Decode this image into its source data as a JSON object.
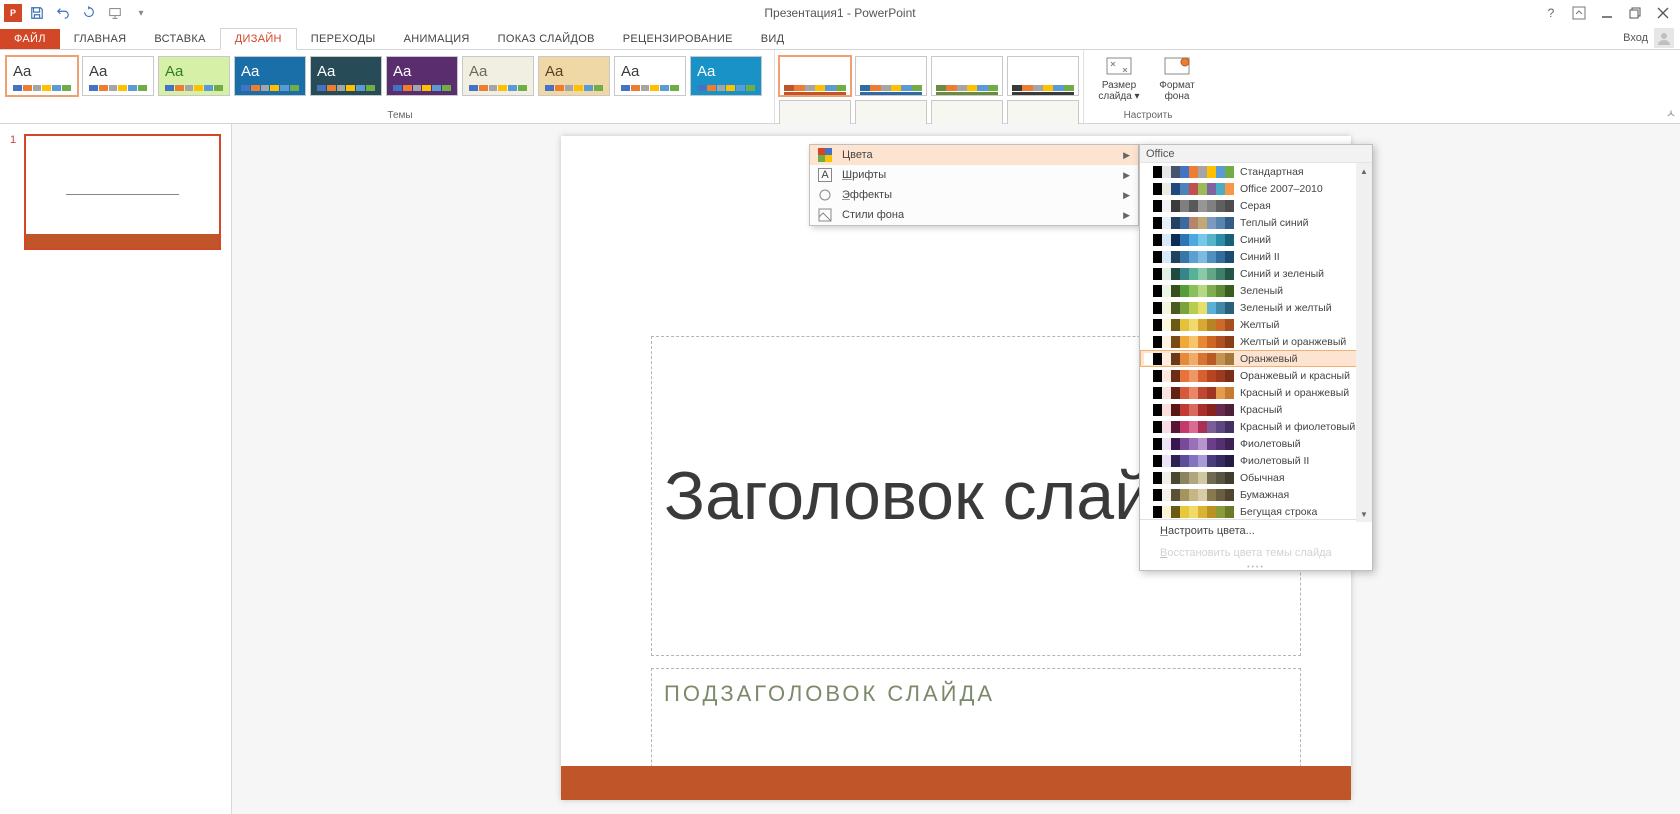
{
  "title": "Презентация1 - PowerPoint",
  "signin": "Вход",
  "tabs": {
    "file": "ФАЙЛ",
    "home": "ГЛАВНАЯ",
    "insert": "ВСТАВКА",
    "design": "ДИЗАЙН",
    "transitions": "ПЕРЕХОДЫ",
    "animations": "АНИМАЦИЯ",
    "slideshow": "ПОКАЗ СЛАЙДОВ",
    "review": "РЕЦЕНЗИРОВАНИЕ",
    "view": "ВИД"
  },
  "ribbon": {
    "themesLabel": "Темы",
    "customizeLabel": "Настроить",
    "slideSize": "Размер слайда",
    "formatBg": "Формат фона",
    "themes": [
      {
        "bg": "#ffffff",
        "fg": "#3b3b3b",
        "selected": true
      },
      {
        "bg": "#ffffff",
        "fg": "#3b3b3b"
      },
      {
        "bg": "#d7f0a8",
        "fg": "#2f7d1f",
        "pattern": "green"
      },
      {
        "bg": "#1b6fa8",
        "fg": "#ffffff",
        "pattern": "blue"
      },
      {
        "bg": "#274c58",
        "fg": "#ffffff"
      },
      {
        "bg": "#5a2e6e",
        "fg": "#ffffff"
      },
      {
        "bg": "#f0efe1",
        "fg": "#6b6b55"
      },
      {
        "bg": "#f0d8a6",
        "fg": "#5a4020",
        "pattern": "wood"
      },
      {
        "bg": "#ffffff",
        "fg": "#3b3b3b"
      },
      {
        "bg": "#1992c8",
        "fg": "#ffffff"
      }
    ],
    "variants": [
      {
        "accent": "#c0552a",
        "selected": true
      },
      {
        "accent": "#2e6ca4"
      },
      {
        "accent": "#6a8c3e"
      },
      {
        "accent": "#3a3a3a"
      },
      {
        "accent": "#35a3b0"
      },
      {
        "accent": "#b54630"
      },
      {
        "accent": "#8e9a78"
      },
      {
        "accent": "#4a4660"
      }
    ]
  },
  "submenu": {
    "colors": "Цвета",
    "fonts": "Шрифты",
    "effects": "Эффекты",
    "bgStyles": "Стили фона"
  },
  "flyout": {
    "header": "Office",
    "customize": "Настроить цвета...",
    "reset": "Восстановить цвета темы слайда",
    "schemes": [
      {
        "name": "Стандартная",
        "c": [
          "#ffffff",
          "#000000",
          "#e7e6e6",
          "#44546a",
          "#4472c4",
          "#ed7d31",
          "#a5a5a5",
          "#ffc000",
          "#5b9bd5",
          "#70ad47"
        ]
      },
      {
        "name": "Office 2007–2010",
        "c": [
          "#ffffff",
          "#000000",
          "#eeece1",
          "#1f497d",
          "#4f81bd",
          "#c0504d",
          "#9bbb59",
          "#8064a2",
          "#4bacc6",
          "#f79646"
        ]
      },
      {
        "name": "Серая",
        "c": [
          "#ffffff",
          "#000000",
          "#f2f2f2",
          "#3b3b3b",
          "#7f7f7f",
          "#595959",
          "#969696",
          "#808080",
          "#5f5f5f",
          "#4d4d4d"
        ]
      },
      {
        "name": "Теплый синий",
        "c": [
          "#ffffff",
          "#000000",
          "#e7eff7",
          "#254061",
          "#3b6aa0",
          "#b4846c",
          "#c1a875",
          "#7a9ac0",
          "#5884b0",
          "#355b87"
        ]
      },
      {
        "name": "Синий",
        "c": [
          "#ffffff",
          "#000000",
          "#dae9f7",
          "#0d2c54",
          "#2e75b6",
          "#4ea8de",
          "#76c7e8",
          "#55b4c8",
          "#2b8ea9",
          "#17607a"
        ]
      },
      {
        "name": "Синий II",
        "c": [
          "#ffffff",
          "#000000",
          "#d8e7f5",
          "#204060",
          "#3776a8",
          "#5aa0d0",
          "#7bbbe0",
          "#4f90c0",
          "#2f6f9f",
          "#1d4c72"
        ]
      },
      {
        "name": "Синий и зеленый",
        "c": [
          "#ffffff",
          "#000000",
          "#e2efe6",
          "#1f4a3f",
          "#37858b",
          "#56b196",
          "#8cc8a6",
          "#61a786",
          "#3c8068",
          "#255645"
        ]
      },
      {
        "name": "Зеленый",
        "c": [
          "#ffffff",
          "#000000",
          "#edf5e4",
          "#374e1f",
          "#549e39",
          "#8bbf5a",
          "#b6d884",
          "#7fae4f",
          "#5d8d35",
          "#3a5e21"
        ]
      },
      {
        "name": "Зеленый и желтый",
        "c": [
          "#ffffff",
          "#000000",
          "#f4f6dc",
          "#4a5a22",
          "#7aa23f",
          "#b8cc52",
          "#e6e06a",
          "#5bb0d8",
          "#3e8aa8",
          "#2a6178"
        ]
      },
      {
        "name": "Желтый",
        "c": [
          "#ffffff",
          "#000000",
          "#fdf7df",
          "#6b5a16",
          "#e3c13b",
          "#f0d96a",
          "#d8a832",
          "#b88322",
          "#cc6a28",
          "#a64f1f"
        ]
      },
      {
        "name": "Желтый и оранжевый",
        "c": [
          "#ffffff",
          "#000000",
          "#fef3e2",
          "#7a4a16",
          "#f0a83b",
          "#f4c56a",
          "#e78832",
          "#cc6622",
          "#b04f1f",
          "#8a3e18"
        ]
      },
      {
        "name": "Оранжевый",
        "hl": true,
        "c": [
          "#ffffff",
          "#000000",
          "#fdeee0",
          "#6b3a16",
          "#e6893b",
          "#f0aa6a",
          "#d87432",
          "#b85a22",
          "#c69450",
          "#a67838"
        ]
      },
      {
        "name": "Оранжевый и красный",
        "c": [
          "#ffffff",
          "#000000",
          "#fce8df",
          "#6a2e16",
          "#e6733b",
          "#ef9666",
          "#d85f32",
          "#b84522",
          "#a03a1d",
          "#7a2e17"
        ]
      },
      {
        "name": "Красный и оранжевый",
        "c": [
          "#ffffff",
          "#000000",
          "#fbe4df",
          "#642216",
          "#d8583b",
          "#e88666",
          "#c04632",
          "#a03622",
          "#e69a4a",
          "#c67a32"
        ]
      },
      {
        "name": "Красный",
        "c": [
          "#ffffff",
          "#000000",
          "#f9dedc",
          "#5a1614",
          "#c23a34",
          "#d86a60",
          "#a83028",
          "#88241e",
          "#6a2a50",
          "#4e1f3a"
        ]
      },
      {
        "name": "Красный и фиолетовый",
        "c": [
          "#ffffff",
          "#000000",
          "#f7dce8",
          "#551636",
          "#c43a6a",
          "#d86a94",
          "#a83056",
          "#7a5e9a",
          "#5e4680",
          "#443060"
        ]
      },
      {
        "name": "Фиолетовый",
        "c": [
          "#ffffff",
          "#000000",
          "#efe2f4",
          "#3a1650",
          "#7a4a9a",
          "#9b70b8",
          "#b694cc",
          "#6a3e88",
          "#543070",
          "#3e2254"
        ]
      },
      {
        "name": "Фиолетовый II",
        "c": [
          "#ffffff",
          "#000000",
          "#ebe4f6",
          "#2e2050",
          "#5e4e9a",
          "#8474c0",
          "#a89cd6",
          "#4a3a80",
          "#362a60",
          "#241c44"
        ]
      },
      {
        "name": "Обычная",
        "c": [
          "#ffffff",
          "#000000",
          "#f0efe7",
          "#4a4632",
          "#8a8460",
          "#b0a780",
          "#d0c8a0",
          "#706a50",
          "#585440",
          "#403c30"
        ]
      },
      {
        "name": "Бумажная",
        "c": [
          "#ffffff",
          "#000000",
          "#f6f2e8",
          "#5a5038",
          "#a69460",
          "#c6b684",
          "#d8cca8",
          "#887850",
          "#6a5e40",
          "#4e4630"
        ]
      },
      {
        "name": "Бегущая строка",
        "c": [
          "#ffffff",
          "#000000",
          "#fdf4d8",
          "#6a5a18",
          "#e6c83b",
          "#f0da6a",
          "#d8b432",
          "#b89222",
          "#8a9c3a",
          "#6a7a2a"
        ]
      }
    ]
  },
  "thumb": {
    "num": "1"
  },
  "slide": {
    "title": "Заголовок слайда",
    "subtitle": "ПОДЗАГОЛОВОК СЛАЙДА"
  }
}
